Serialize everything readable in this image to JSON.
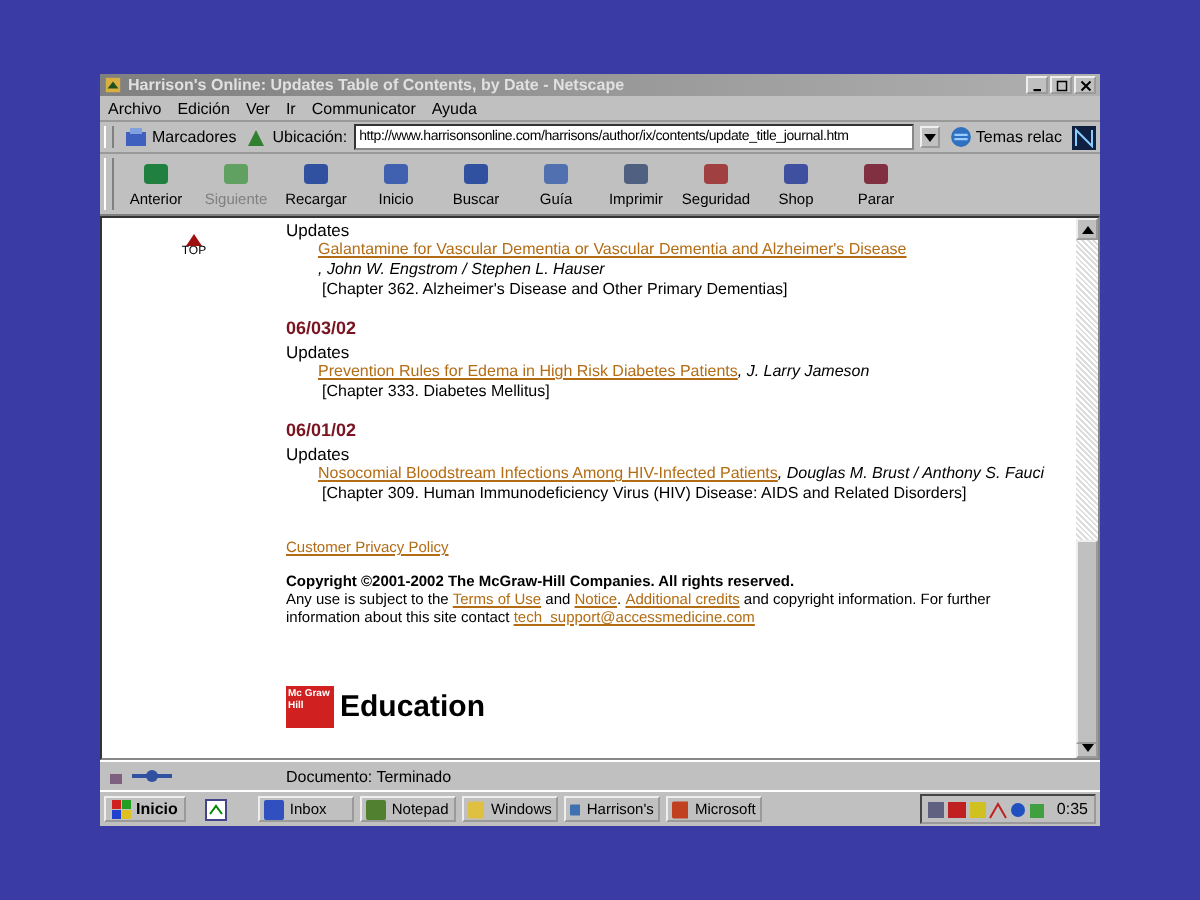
{
  "window": {
    "title": "Harrison's Online: Updates Table of Contents, by Date - Netscape"
  },
  "menu": [
    "Archivo",
    "Edición",
    "Ver",
    "Ir",
    "Communicator",
    "Ayuda"
  ],
  "location_bar": {
    "bookmarks": "Marcadores",
    "location_label": "Ubicación:",
    "url": "http://www.harrisonsonline.com/harrisons/author/ix/contents/update_title_journal.htm",
    "related": "Temas relac"
  },
  "toolbar": [
    "Anterior",
    "Siguiente",
    "Recargar",
    "Inicio",
    "Buscar",
    "Guía",
    "Imprimir",
    "Seguridad",
    "Shop",
    "Parar"
  ],
  "content": {
    "top_link": "TOP",
    "sections": [
      {
        "heading": "Updates",
        "entries": [
          {
            "title": "Galantamine for Vascular Dementia or Vascular Dementia and Alzheimer's Disease",
            "authors": ", John W. Engstrom / Stephen L. Hauser",
            "chapter": "[Chapter 362. Alzheimer's Disease and Other Primary Dementias]"
          }
        ]
      },
      {
        "date": "06/03/02",
        "heading": "Updates",
        "entries": [
          {
            "title": "Prevention Rules for Edema in High Risk Diabetes Patients",
            "authors": ", J. Larry Jameson",
            "chapter": "[Chapter 333. Diabetes Mellitus]"
          }
        ]
      },
      {
        "date": "06/01/02",
        "heading": "Updates",
        "entries": [
          {
            "title": "Nosocomial Bloodstream Infections Among HIV-Infected Patients",
            "authors": ", Douglas M. Brust / Anthony S. Fauci",
            "chapter": "[Chapter 309. Human Immunodeficiency Virus (HIV) Disease: AIDS and Related Disorders]"
          }
        ]
      }
    ]
  },
  "footer": {
    "privacy_link": "Customer Privacy Policy",
    "copyright": "Copyright ©2001-2002 The McGraw-Hill Companies. All rights reserved.",
    "notice": [
      {
        "text": "Any use is subject to the ",
        "link": false
      },
      {
        "text": "Terms of Use",
        "link": true
      },
      {
        "text": " and ",
        "link": false
      },
      {
        "text": "Notice",
        "link": true
      },
      {
        "text": ". ",
        "link": false
      },
      {
        "text": "Additional credits",
        "link": true
      },
      {
        "text": " and copyright information. For further",
        "link": false
      },
      {
        "text": "information about this site contact ",
        "link": false
      },
      {
        "text": "tech_support@accessmedicine.com",
        "link": true
      }
    ],
    "logo_mark": "Mc Graw Hill",
    "logo_word": "Education"
  },
  "status_bar": {
    "text": "Documento: Terminado"
  },
  "taskbar": {
    "start": "Inicio",
    "tasks": [
      "Inbox",
      "Notepad",
      "Windows",
      "Harrison's",
      "Microsoft"
    ],
    "clock": "0:35"
  }
}
